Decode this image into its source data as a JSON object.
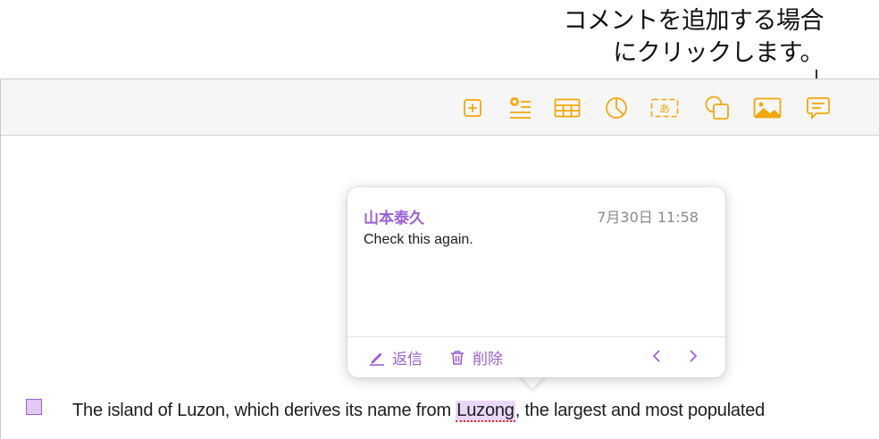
{
  "callout": {
    "line1": "コメントを追加する場合",
    "line2": "にクリックします。"
  },
  "toolbar": {
    "accent_color": "#f2a80c",
    "buttons": [
      {
        "icon": "insert-icon"
      },
      {
        "icon": "list-add-icon"
      },
      {
        "icon": "table-icon"
      },
      {
        "icon": "chart-icon"
      },
      {
        "icon": "text-box-icon"
      },
      {
        "icon": "shape-icon"
      },
      {
        "icon": "media-icon"
      },
      {
        "icon": "comment-icon"
      }
    ]
  },
  "comment": {
    "author": "山本泰久",
    "timestamp": "7月30日 11:58",
    "text": "Check this again.",
    "reply_label": "返信",
    "delete_label": "削除",
    "accent_color": "#9b61d6"
  },
  "document": {
    "text_before": "The island of Luzon, which derives its name from ",
    "highlighted_word": "Luzong",
    "text_after": ", the largest and most populated"
  }
}
